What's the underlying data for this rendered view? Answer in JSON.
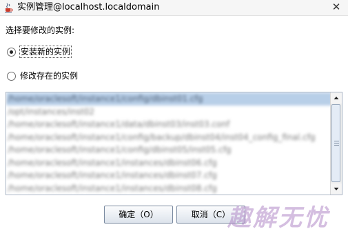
{
  "window": {
    "title": "实例管理@localhost.localdomain",
    "app_icon": "java-cup-icon",
    "close_label": "✕"
  },
  "prompt": "选择要修改的实例:",
  "options": [
    {
      "label": "安装新的实例",
      "checked": true
    },
    {
      "label": "修改存在的实例",
      "checked": false
    }
  ],
  "instance_list": {
    "items": [
      "/home/oraclesoft/instance1/config/dbinst01.cfg",
      "/opt/instances/inst02",
      "/home/oraclesoft/instance1/data/dbinst03/inst03.conf",
      "/home/oraclesoft/instance1/config/backup/dbinst04/inst04_config_final.cfg",
      "/home/oraclesoft/instance1/config/dbinst05/inst05.cfg",
      "/home/oraclesoft/instance1/instances/dbinst06.cfg",
      "/home/oraclesoft/instance1/instances/dbinst07.cfg",
      "/home/oraclesoft/instance1/instances/dbinst08.cfg"
    ],
    "selected_index": 0
  },
  "buttons": {
    "ok": "确定（O）",
    "cancel": "取消（C）"
  },
  "watermark": "趣解无忧"
}
